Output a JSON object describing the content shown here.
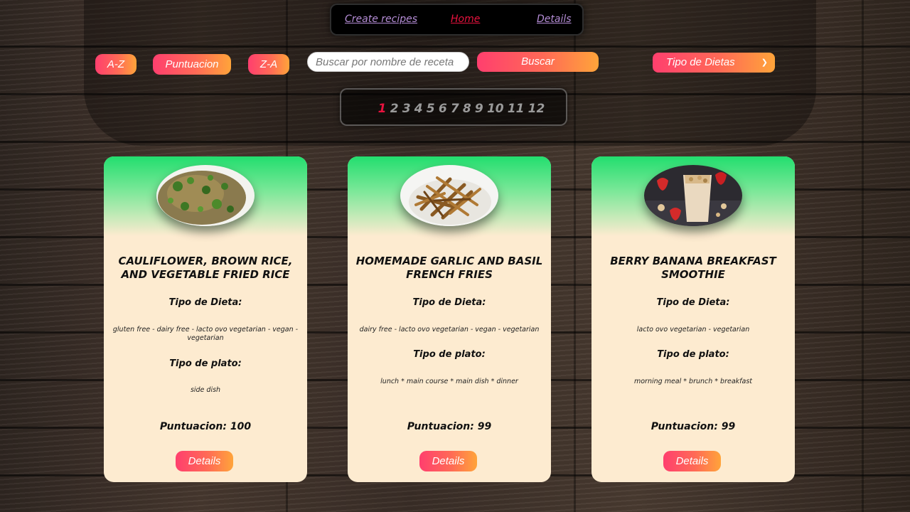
{
  "nav": {
    "create_label": "Create recipes",
    "home_label": "Home",
    "details_label": "Details"
  },
  "filters": {
    "az_label": "A-Z",
    "puntuacion_label": "Puntuacion",
    "za_label": "Z-A",
    "search_placeholder": "Buscar por nombre de receta",
    "search_value": "",
    "search_button_label": "Buscar",
    "diet_select_value": "Tipo de Dietas"
  },
  "pagination": {
    "current": "1",
    "pages": [
      "1",
      "2",
      "3",
      "4",
      "5",
      "6",
      "7",
      "8",
      "9",
      "10",
      "11",
      "12"
    ]
  },
  "labels": {
    "diet_heading": "Tipo de Dieta:",
    "dish_heading": "Tipo de plato:",
    "details_button": "Details"
  },
  "recipes": [
    {
      "title": "Cauliflower, Brown Rice, and Vegetable Fried Rice",
      "diets": "gluten free - dairy free - lacto ovo vegetarian - vegan - vegetarian",
      "dish_types": "side dish",
      "score": "Puntuacion: 100",
      "image": "fried-rice-photo"
    },
    {
      "title": "Homemade Garlic and Basil French Fries",
      "diets": "dairy free - lacto ovo vegetarian - vegan - vegetarian",
      "dish_types": "lunch * main course * main dish * dinner",
      "score": "Puntuacion: 99",
      "image": "french-fries-photo"
    },
    {
      "title": "Berry Banana Breakfast Smoothie",
      "diets": "lacto ovo vegetarian - vegetarian",
      "dish_types": "morning meal * brunch * breakfast",
      "score": "Puntuacion: 99",
      "image": "smoothie-photo"
    }
  ],
  "colors": {
    "accent_gradient_start": "#ff3f6e",
    "accent_gradient_end": "#ffa43a",
    "active_link": "#e8123e",
    "card_background": "#fdebd0",
    "card_top_green": "#22de6e"
  }
}
